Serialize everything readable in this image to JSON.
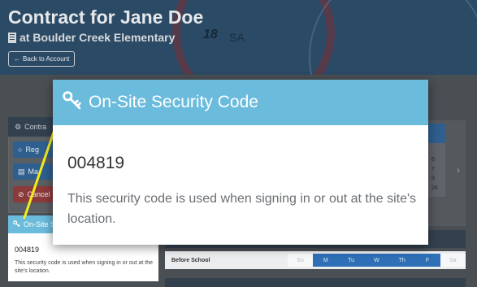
{
  "header": {
    "title": "Contract for Jane Doe",
    "subtitle": "at Boulder Creek Elementary",
    "back_label": "Back to Account",
    "bg_numbers": [
      "18",
      "SA"
    ]
  },
  "sidebar": {
    "panel_title": "Contra",
    "buttons": [
      "Reg",
      "Ma",
      "Cancel"
    ]
  },
  "calendar": {
    "visible_dates": [
      "6",
      "7",
      "9",
      "26"
    ]
  },
  "schedule": {
    "row_label": "Before School",
    "days": [
      {
        "label": "Su",
        "active": false
      },
      {
        "label": "M",
        "active": true
      },
      {
        "label": "Tu",
        "active": true
      },
      {
        "label": "W",
        "active": true
      },
      {
        "label": "Th",
        "active": true
      },
      {
        "label": "F",
        "active": true
      },
      {
        "label": "Sa",
        "active": false
      }
    ]
  },
  "small_card": {
    "title": "On-Site S",
    "code": "004819",
    "description": "This security code is used when signing in or out at the site's location."
  },
  "modal": {
    "title": "On-Site Security Code",
    "code": "004819",
    "description": "This security code is used when signing in or out at the site's location."
  },
  "colors": {
    "accent": "#6bbbdc",
    "annotation": "#f5ec1c",
    "active_day": "#2e6fb5"
  }
}
